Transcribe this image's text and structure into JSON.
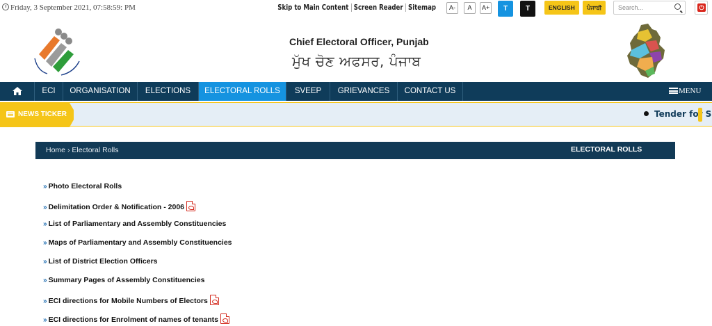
{
  "topbar": {
    "datetime": "Friday, 3 September 2021, 07:58:59: PM",
    "links": [
      "Skip to Main Content",
      "Screen Reader",
      "Sitemap"
    ],
    "font_sizes": [
      "A-",
      "A",
      "A+"
    ],
    "theme_buttons": [
      {
        "label": "T",
        "color": "#1593e0"
      },
      {
        "label": "T",
        "color": "#111111"
      }
    ],
    "languages": [
      "ENGLISH",
      "ਪੰਜਾਬੀ"
    ],
    "search_placeholder": "Search..."
  },
  "header": {
    "title_en": "Chief Electoral Officer, Punjab",
    "title_pa": "ਮੁੱਖ ਚੋਣ ਅਫਸਰ, ਪੰਜਾਬ"
  },
  "nav": {
    "items": [
      "ECI",
      "ORGANISATION",
      "ELECTIONS",
      "ELECTORAL ROLLS",
      "SVEEP",
      "GRIEVANCES",
      "CONTACT US"
    ],
    "active": "ELECTORAL ROLLS",
    "menu_label": "MENU"
  },
  "ticker": {
    "label": "NEWS TICKER",
    "text": "Tender for Supl"
  },
  "breadcrumb": {
    "home": "Home",
    "separator": "›",
    "current": "Electoral Rolls",
    "page_title": "ELECTORAL ROLLS"
  },
  "links": [
    {
      "label": "Photo Electoral Rolls",
      "pdf": false
    },
    {
      "label": "Delimitation Order & Notification - 2006",
      "pdf": true
    },
    {
      "label": "List of Parliamentary and Assembly Constituencies",
      "pdf": false
    },
    {
      "label": "Maps of Parliamentary and Assembly Constituencies",
      "pdf": false
    },
    {
      "label": "List of District Election Officers",
      "pdf": false
    },
    {
      "label": "Summary Pages of Assembly Constituencies",
      "pdf": false
    },
    {
      "label": "ECI directions for Mobile Numbers of Electors",
      "pdf": true
    },
    {
      "label": "ECI directions for Enrolment of names of tenants",
      "pdf": true
    }
  ],
  "colors": {
    "nav_bg": "#0f3c5a",
    "nav_active": "#1593e0",
    "accent_yellow": "#f5c518",
    "ticker_bg": "#e5eef6",
    "pdf_red": "#d42a1e"
  }
}
